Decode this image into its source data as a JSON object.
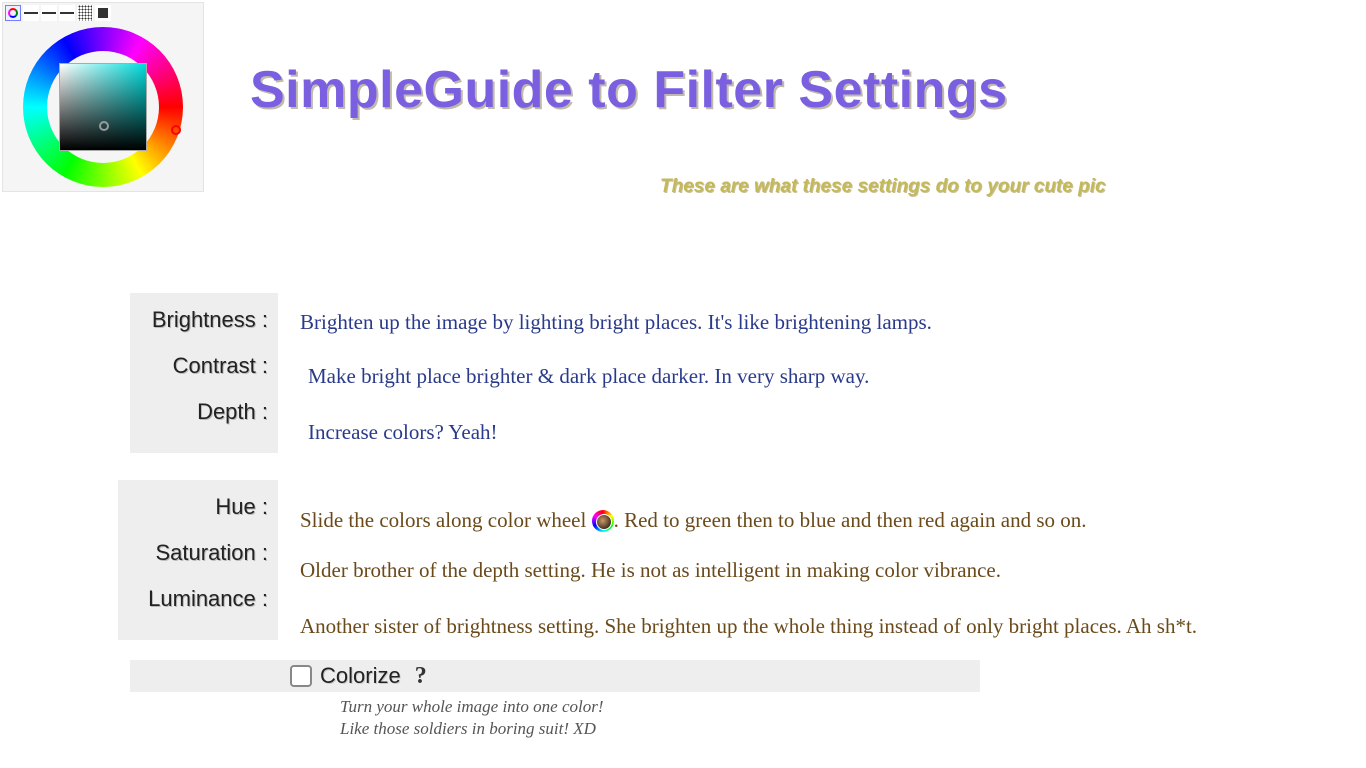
{
  "title": "SimpleGuide to Filter Settings",
  "subtitle": "These are what these settings do to your cute pic",
  "group1": {
    "brightness": {
      "label": "Brightness :",
      "desc": "Brighten up the image by lighting bright places. It's like brightening lamps."
    },
    "contrast": {
      "label": "Contrast :",
      "desc": "Make bright place brighter & dark place darker. In very sharp way."
    },
    "depth": {
      "label": "Depth :",
      "desc": "Increase colors? Yeah!"
    }
  },
  "group2": {
    "hue": {
      "label": "Hue :",
      "desc_before": "Slide the colors along color wheel",
      "desc_after": ". Red to green then to blue and then red again and so on."
    },
    "saturation": {
      "label": "Saturation :",
      "desc": "Older brother of the depth setting. He is not as intelligent in making color vibrance."
    },
    "luminance": {
      "label": "Luminance :",
      "desc": "Another sister of brightness setting. She brighten up the whole thing instead of only bright places. Ah sh*t."
    }
  },
  "colorize": {
    "label": "Colorize",
    "help_glyph": "?",
    "caption_line1": "Turn your whole image into one color!",
    "caption_line2": "Like those soldiers in boring suit! XD"
  }
}
